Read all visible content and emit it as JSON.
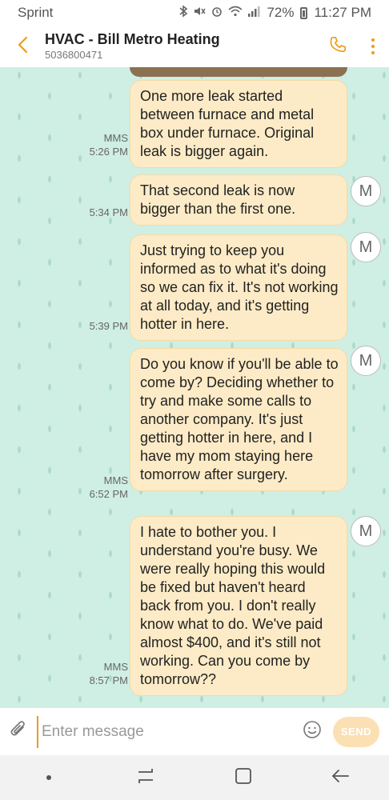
{
  "status_bar": {
    "carrier": "Sprint",
    "battery": "72%",
    "time": "11:27 PM"
  },
  "header": {
    "contact_name": "HVAC - Bill Metro Heating",
    "contact_number": "5036800471",
    "icons": {
      "back": "back-arrow-icon",
      "call": "phone-icon",
      "more": "more-vertical-icon"
    },
    "accent_color": "#f09a1a"
  },
  "messages": [
    {
      "text": "One more leak started between furnace and metal box under furnace. Original leak is bigger again.",
      "type": "MMS",
      "time": "5:26 PM",
      "avatar": ""
    },
    {
      "text": "That second leak is now bigger than the first one.",
      "type": "",
      "time": "5:34 PM",
      "avatar": "M"
    },
    {
      "text": "Just trying to keep you informed as to what it's doing so we can fix it. It's not working at all today, and it's getting hotter in here.",
      "type": "",
      "time": "5:39 PM",
      "avatar": "M"
    },
    {
      "text": "Do you know if you'll be able to come by? Deciding whether to try and make some calls to another company. It's just getting hotter in here, and I have my mom staying here tomorrow after surgery.",
      "type": "MMS",
      "time": "6:52 PM",
      "avatar": "M"
    },
    {
      "text": "I hate to bother you. I understand you're busy. We were really hoping this would be fixed but haven't heard back from you. I don't really know what to do. We've paid almost $400, and it's still not working. Can you come by tomorrow??",
      "type": "MMS",
      "time": "8:57 PM",
      "avatar": "M"
    }
  ],
  "composer": {
    "placeholder": "Enter message",
    "send_label": "SEND"
  },
  "colors": {
    "bubble": "#fcebc6",
    "chat_background": "#cfeee4",
    "accent": "#f09a1a"
  }
}
